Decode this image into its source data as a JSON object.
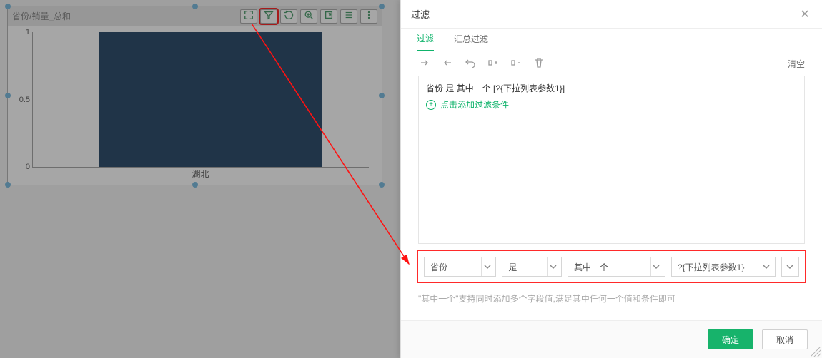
{
  "widget": {
    "title": "省份/销量_总和"
  },
  "chart_data": {
    "type": "bar",
    "categories": [
      "湖北"
    ],
    "values": [
      1.0
    ],
    "xlabel": "",
    "ylabel": "",
    "ylim": [
      0,
      1.0
    ],
    "yticks": [
      0.0,
      0.5,
      1.0
    ]
  },
  "panel": {
    "title": "过滤",
    "tabs": {
      "filter": "过滤",
      "summary_filter": "汇总过滤"
    },
    "clear": "清空",
    "condition_text": "省份 是 其中一个 [?{下拉列表参数1}]",
    "add_condition": "点击添加过滤条件",
    "builder": {
      "field": "省份",
      "op": "是",
      "match": "其中一个",
      "value": "?{下拉列表参数1}"
    },
    "hint": "\"其中一个\"支持同时添加多个字段值,满足其中任何一个值和条件即可",
    "ok": "确定",
    "cancel": "取消"
  }
}
